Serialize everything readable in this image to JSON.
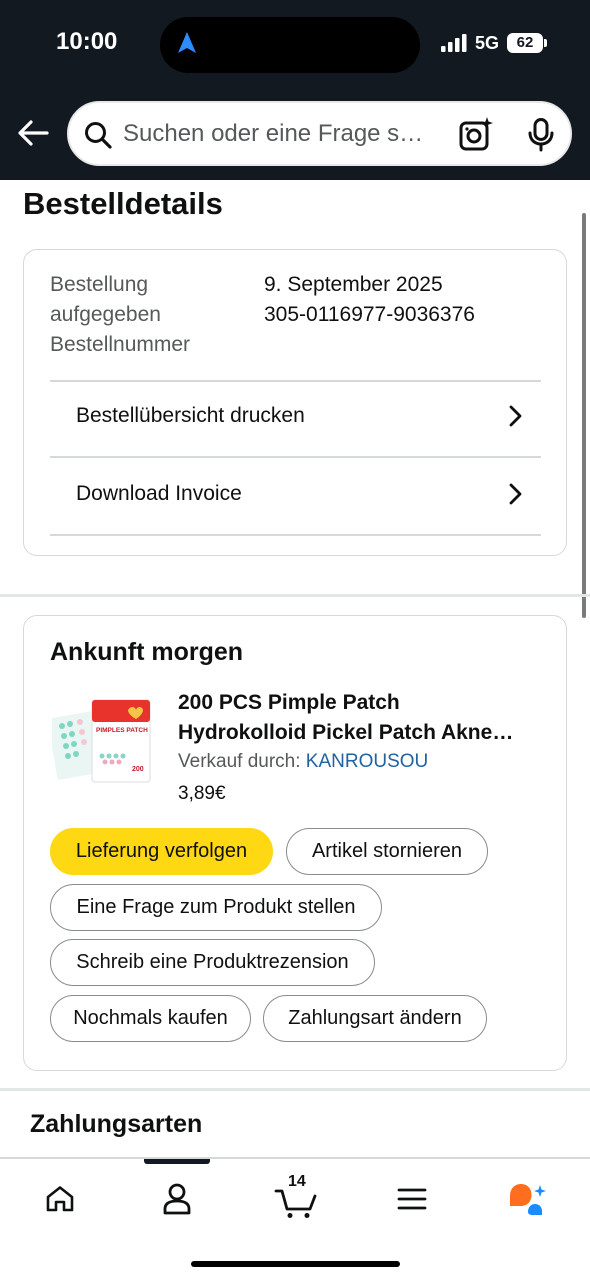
{
  "status_bar": {
    "time": "10:00",
    "network": "5G",
    "battery": "62"
  },
  "header": {
    "search_placeholder": "Suchen oder eine Frage s…",
    "icons": [
      "back-arrow-icon",
      "search-icon",
      "camera-sparkle-icon",
      "microphone-icon"
    ]
  },
  "page": {
    "title": "Bestelldetails"
  },
  "order_info": {
    "label": "Bestellung\naufgegeben\nBestellnummer",
    "date": "9. September 2025",
    "number": "305-0116977-9036376",
    "links": [
      {
        "label": "Bestellübersicht drucken"
      },
      {
        "label": "Download Invoice"
      }
    ]
  },
  "shipment": {
    "arrival": "Ankunft morgen",
    "product": {
      "title_line1": "200 PCS Pimple Patch",
      "title_line2": "Hydrokolloid Pickel Patch Akne…",
      "seller_prefix": "Verkauf durch: ",
      "seller": "KANROUSOU",
      "price": "3,89€",
      "image_text": "PIMPLES PATCH",
      "image_count": "200"
    },
    "actions": [
      {
        "label": "Lieferung verfolgen"
      },
      {
        "label": "Artikel stornieren"
      },
      {
        "label": "Eine Frage zum Produkt stellen"
      },
      {
        "label": "Schreib eine Produktrezension"
      },
      {
        "label": "Nochmals kaufen"
      },
      {
        "label": "Zahlungsart ändern"
      }
    ]
  },
  "payments": {
    "title": "Zahlungsarten"
  },
  "bottom_nav": {
    "items": [
      "home-icon",
      "account-icon",
      "cart-icon",
      "menu-icon",
      "rufus-assistant-icon"
    ],
    "cart_count": "14"
  },
  "colors": {
    "header_bg": "#131921",
    "primary_button": "#ffd814",
    "link": "#2162a1",
    "assistant_orange": "#ff6e1f",
    "assistant_blue": "#1a8cff"
  }
}
